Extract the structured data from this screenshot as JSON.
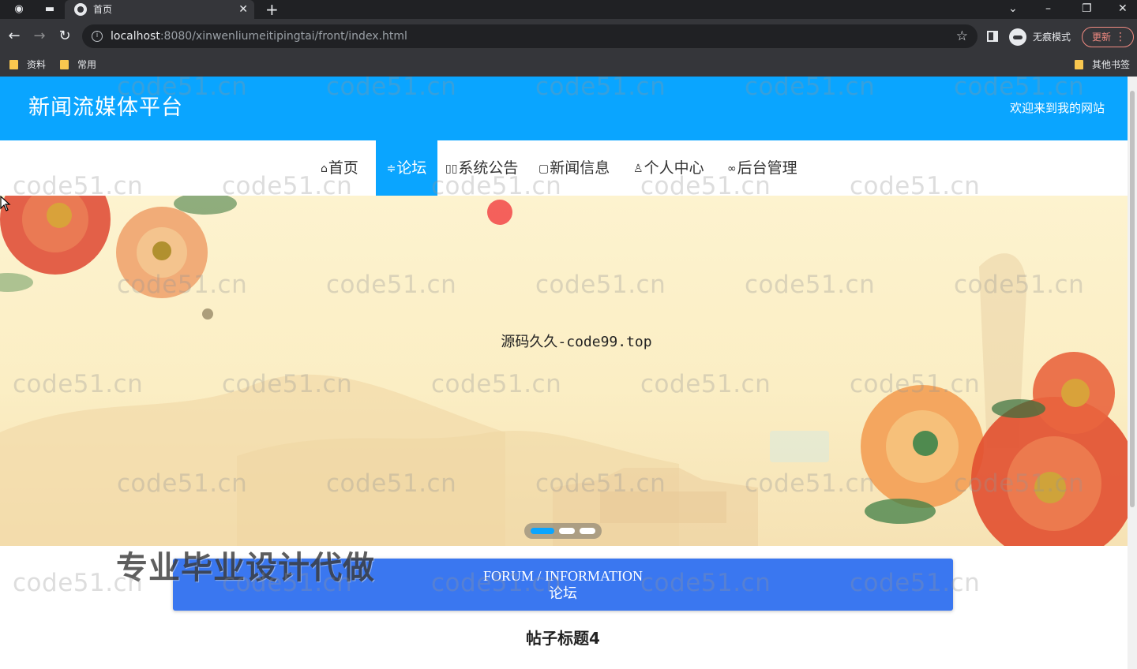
{
  "browser": {
    "tab_title": "首页",
    "new_tab_icon": "plus-icon",
    "url_host": "localhost",
    "url_rest": ":8080/xinwenliumeitipingtai/front/index.html",
    "incognito_label": "无痕模式",
    "update_label": "更新",
    "bookmarks": [
      "资料",
      "常用"
    ],
    "other_bookmarks": "其他书签"
  },
  "site": {
    "title": "新闻流媒体平台",
    "welcome": "欢迎来到我的网站"
  },
  "nav": {
    "items": [
      {
        "icon": "home-icon",
        "glyph": "⌂",
        "label": "首页"
      },
      {
        "icon": "forum-icon",
        "glyph": "≑",
        "label": "论坛"
      },
      {
        "icon": "notice-icon",
        "glyph": "▯▯",
        "label": "系统公告"
      },
      {
        "icon": "news-icon",
        "glyph": "▢",
        "label": "新闻信息"
      },
      {
        "icon": "user-icon",
        "glyph": "♙",
        "label": "个人中心"
      },
      {
        "icon": "link-icon",
        "glyph": "∞",
        "label": "后台管理"
      }
    ],
    "active_index": 1
  },
  "banner": {
    "caption": "源码久久-code99.top",
    "slides": 3,
    "active_slide": 1
  },
  "section": {
    "title_en": "FORUM / INFORMATION",
    "title_zh": "论坛"
  },
  "promo_overlay": "专业毕业设计代做",
  "post": {
    "title": "帖子标题4"
  },
  "watermark": "code51.cn",
  "colors": {
    "primary": "#0aa5ff",
    "section_bar": "#3a77f0"
  }
}
